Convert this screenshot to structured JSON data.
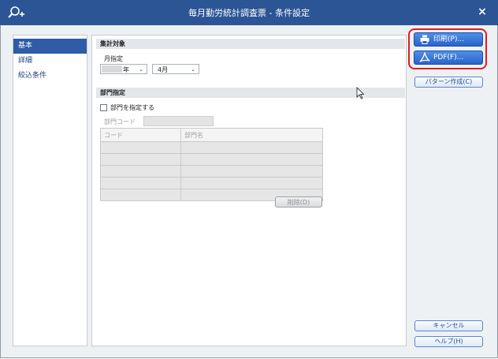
{
  "titlebar": {
    "title": "毎月勤労統計調査票 - 条件設定",
    "close_symbol": "×",
    "app_icon": "search-plus-icon"
  },
  "sidebar": {
    "items": [
      {
        "label": "基本",
        "active": true
      },
      {
        "label": "詳細",
        "active": false
      },
      {
        "label": "絞込条件",
        "active": false
      }
    ]
  },
  "aggregation": {
    "section_title": "集計対象",
    "month_label": "月指定",
    "year_suffix": "年",
    "month_value": "4月"
  },
  "department": {
    "section_title": "部門指定",
    "checkbox_label": "部門を指定する",
    "code_label": "部門コード",
    "columns": [
      "コード",
      "部門名"
    ],
    "delete_label": "削除(D)"
  },
  "actions": {
    "print_label": "印刷(P)...",
    "pdf_label": "PDF(F)...",
    "pattern_label": "パターン作成(C)",
    "cancel_label": "キャンセル",
    "help_label": "ヘルプ(H)"
  },
  "colors": {
    "titlebar": "#2b5594",
    "accent": "#2a63c8",
    "highlight": "#e01d1d"
  }
}
